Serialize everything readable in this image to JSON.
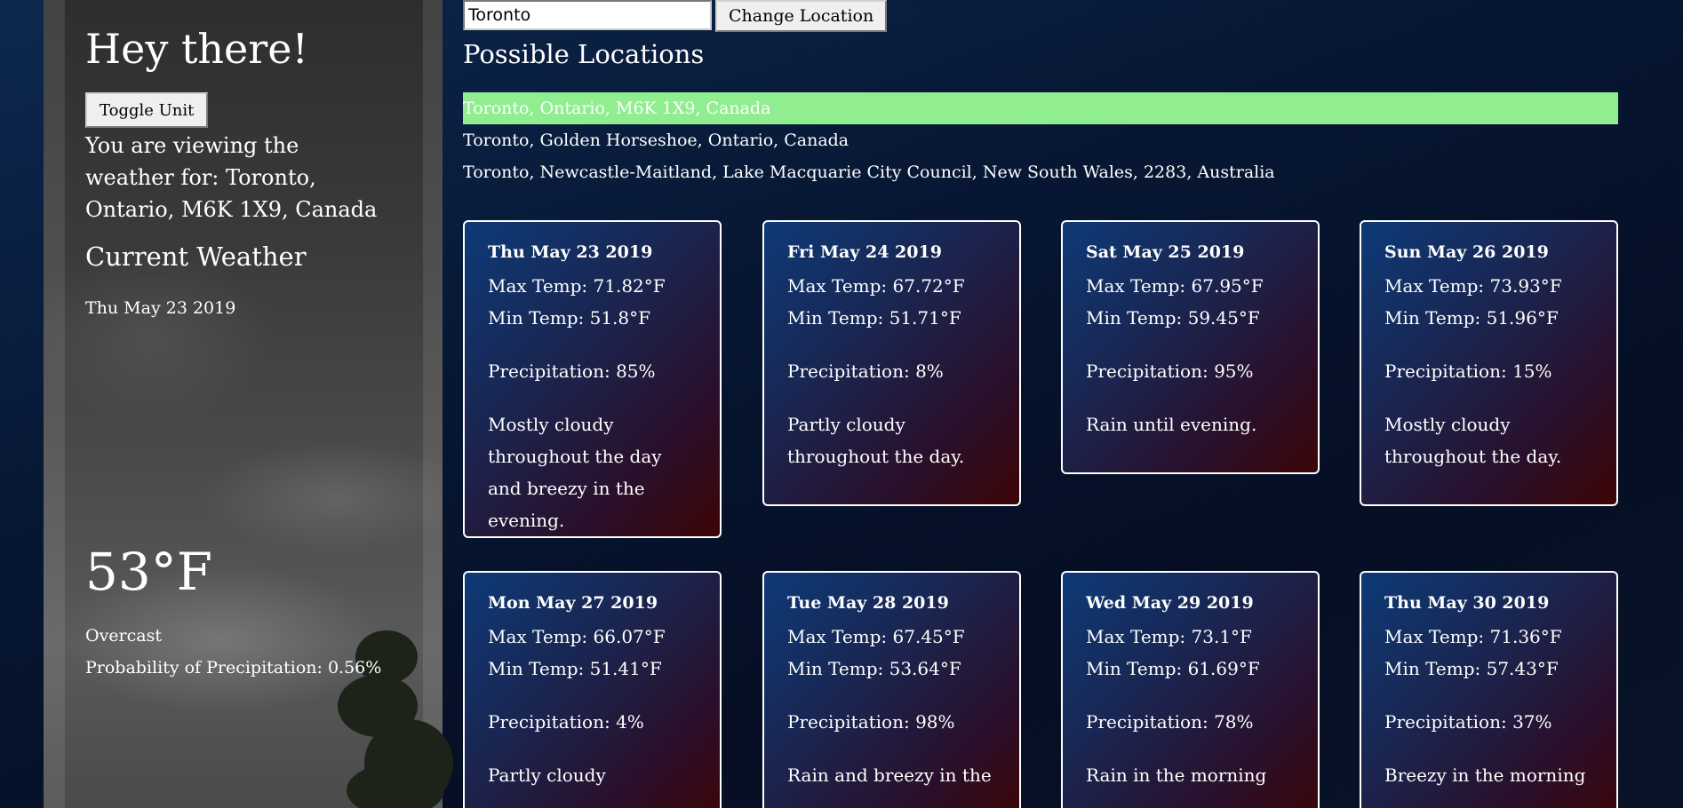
{
  "sidebar": {
    "greeting": "Hey there!",
    "toggle_label": "Toggle Unit",
    "viewing_text": "You are viewing the weather for: Toronto, Ontario, M6K 1X9, Canada",
    "current_title": "Current Weather",
    "current_date": "Thu May 23 2019",
    "current_temp": "53°F",
    "condition": "Overcast",
    "precip_probability": "Probability of Precipitation: 0.56%"
  },
  "search": {
    "value": "Toronto",
    "button_label": "Change Location"
  },
  "possible_title": "Possible Locations",
  "locations": [
    {
      "label": "Toronto, Ontario, M6K 1X9, Canada",
      "selected": true
    },
    {
      "label": "Toronto, Golden Horseshoe, Ontario, Canada",
      "selected": false
    },
    {
      "label": "Toronto, Newcastle-Maitland, Lake Macquarie City Council, New South Wales, 2283, Australia",
      "selected": false
    }
  ],
  "forecast": [
    {
      "date": "Thu May 23 2019",
      "max": "Max Temp: 71.82°F",
      "min": "Min Temp: 51.8°F",
      "precip": "Precipitation: 85%",
      "summary": "Mostly cloudy throughout the day and breezy in the evening."
    },
    {
      "date": "Fri May 24 2019",
      "max": "Max Temp: 67.72°F",
      "min": "Min Temp: 51.71°F",
      "precip": "Precipitation: 8%",
      "summary": "Partly cloudy throughout the day."
    },
    {
      "date": "Sat May 25 2019",
      "max": "Max Temp: 67.95°F",
      "min": "Min Temp: 59.45°F",
      "precip": "Precipitation: 95%",
      "summary": "Rain until evening."
    },
    {
      "date": "Sun May 26 2019",
      "max": "Max Temp: 73.93°F",
      "min": "Min Temp: 51.96°F",
      "precip": "Precipitation: 15%",
      "summary": "Mostly cloudy throughout the day."
    },
    {
      "date": "Mon May 27 2019",
      "max": "Max Temp: 66.07°F",
      "min": "Min Temp: 51.41°F",
      "precip": "Precipitation: 4%",
      "summary": "Partly cloudy"
    },
    {
      "date": "Tue May 28 2019",
      "max": "Max Temp: 67.45°F",
      "min": "Min Temp: 53.64°F",
      "precip": "Precipitation: 98%",
      "summary": "Rain and breezy in the"
    },
    {
      "date": "Wed May 29 2019",
      "max": "Max Temp: 73.1°F",
      "min": "Min Temp: 61.69°F",
      "precip": "Precipitation: 78%",
      "summary": "Rain in the morning"
    },
    {
      "date": "Thu May 30 2019",
      "max": "Max Temp: 71.36°F",
      "min": "Min Temp: 57.43°F",
      "precip": "Precipitation: 37%",
      "summary": "Breezy in the morning"
    }
  ],
  "colors": {
    "selected_location": "#90ee90",
    "card_border": "#ffffff",
    "background": "#071733"
  }
}
